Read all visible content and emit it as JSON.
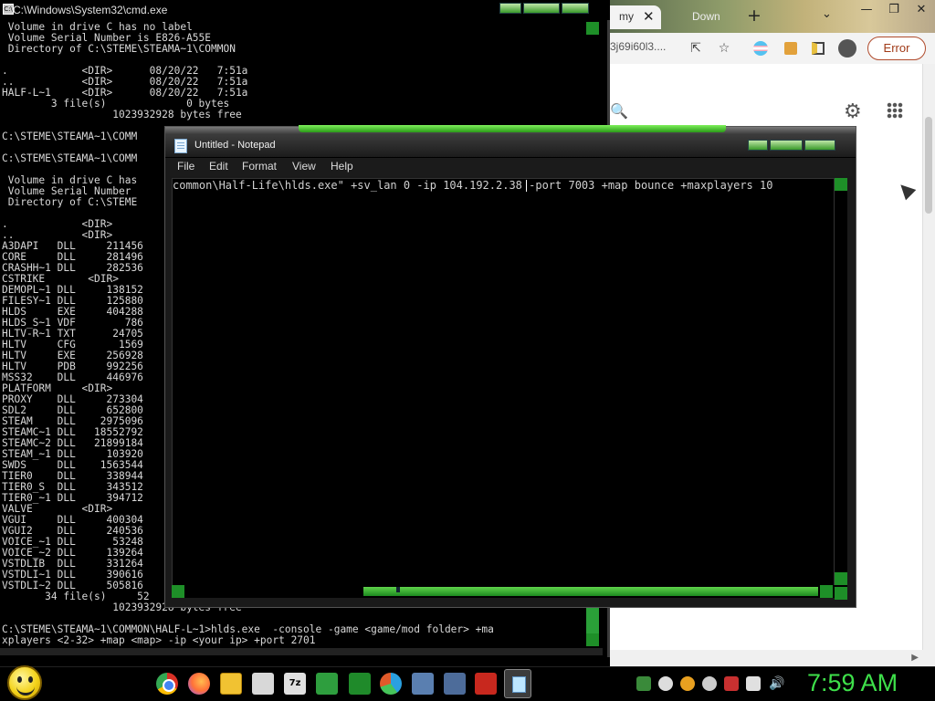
{
  "browser": {
    "tabs": [
      {
        "label": "my"
      },
      {
        "label": "Down"
      }
    ],
    "url_fragment": "3j69i60l3....",
    "error_button": "Error"
  },
  "cmd": {
    "title": "C:\\Windows\\System32\\cmd.exe",
    "lines": [
      " Volume in drive C has no label",
      " Volume Serial Number is E826-A55E",
      " Directory of C:\\STEME\\STEAMA~1\\COMMON",
      "",
      ".            <DIR>      08/20/22   7:51a",
      "..           <DIR>      08/20/22   7:51a",
      "HALF-L~1     <DIR>      08/20/22   7:51a",
      "        3 file(s)             0 bytes",
      "                  1023932928 bytes free",
      "",
      "C:\\STEME\\STEAMA~1\\COMM",
      "",
      "C:\\STEME\\STEAMA~1\\COMM",
      "",
      " Volume in drive C has",
      " Volume Serial Number",
      " Directory of C:\\STEME",
      "",
      ".            <DIR>",
      "..           <DIR>",
      "A3DAPI   DLL     211456",
      "CORE     DLL     281496",
      "CRASHH~1 DLL     282536",
      "CSTRIKE       <DIR>",
      "DEMOPL~1 DLL     138152",
      "FILESY~1 DLL     125880",
      "HLDS     EXE     404288",
      "HLDS_S~1 VDF        786",
      "HLTV-R~1 TXT      24705",
      "HLTV     CFG       1569",
      "HLTV     EXE     256928",
      "HLTV     PDB     992256",
      "MSS32    DLL     446976",
      "PLATFORM     <DIR>",
      "PROXY    DLL     273304",
      "SDL2     DLL     652800",
      "STEAM    DLL    2975096",
      "STEAMC~1 DLL   18552792",
      "STEAMC~2 DLL   21899184",
      "STEAM_~1 DLL     103920",
      "SWDS     DLL    1563544",
      "TIER0    DLL     338944",
      "TIER0_S  DLL     343512",
      "TIER0_~1 DLL     394712",
      "VALVE        <DIR>",
      "VGUI     DLL     400304",
      "VGUI2    DLL     240536",
      "VOICE_~1 DLL      53248",
      "VOICE_~2 DLL     139264",
      "VSTDLIB  DLL     331264",
      "VSTDLI~1 DLL     390616",
      "VSTDLI~2 DLL     505816",
      "       34 file(s)     52",
      "                  1023932928 bytes free",
      "",
      "C:\\STEME\\STEAMA~1\\COMMON\\HALF-L~1>hlds.exe  -console -game <game/mod folder> +ma",
      "xplayers <2-32> +map <map> -ip <your ip> +port 2701"
    ]
  },
  "notepad": {
    "title": "Untitled - Notepad",
    "menu": [
      "File",
      "Edit",
      "Format",
      "View",
      "Help"
    ],
    "content": "common\\Half-Life\\hlds.exe\" +sv_lan 0 -ip 104.192.2.38 -port 7003 +map bounce +maxplayers 10"
  },
  "taskbar": {
    "clock": "7:59 AM",
    "zip_label": "7z"
  },
  "colors": {
    "accent_green": "#3ee04a",
    "cmd_bg": "#000000",
    "error_border": "#b04b2c"
  }
}
